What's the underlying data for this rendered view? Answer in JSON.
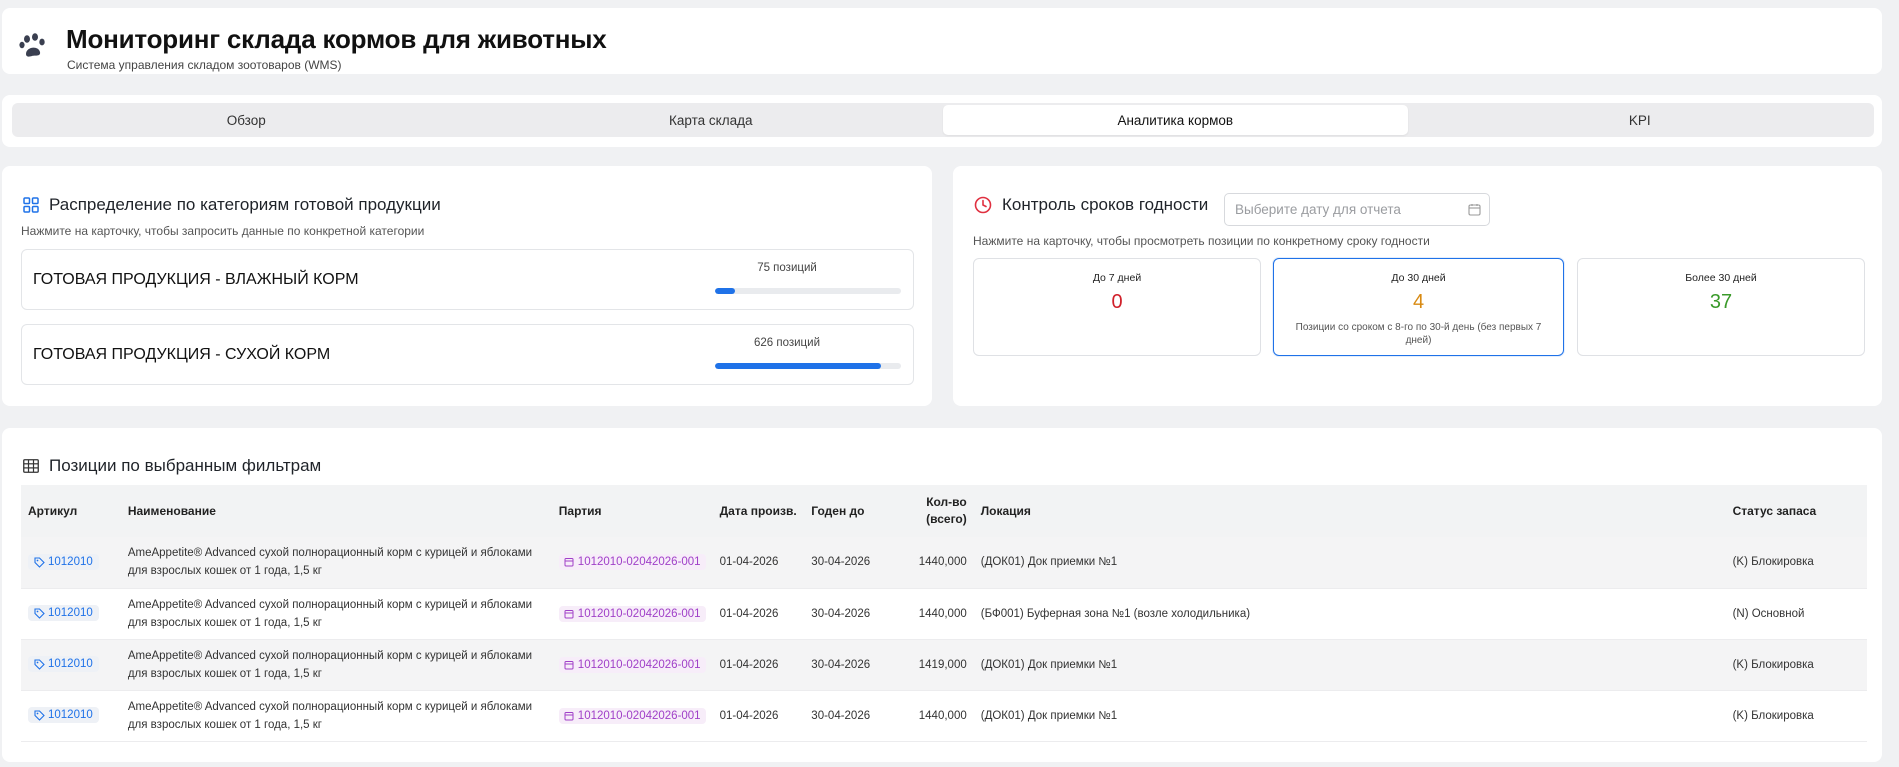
{
  "header": {
    "title": "Мониторинг склада кормов для животных",
    "subtitle": "Система управления складом зоотоваров (WMS)",
    "icon": "paw-icon"
  },
  "tabs": [
    {
      "label": "Обзор",
      "active": false
    },
    {
      "label": "Карта склада",
      "active": false
    },
    {
      "label": "Аналитика кормов",
      "active": true
    },
    {
      "label": "KPI",
      "active": false
    }
  ],
  "categories": {
    "title": "Распределение по категориям готовой продукции",
    "hint": "Нажмите на карточку, чтобы запросить данные по конкретной категории",
    "items": [
      {
        "name": "ГОТОВАЯ ПРОДУКЦИЯ - ВЛАЖНЫЙ КОРМ",
        "count": "75 позиций",
        "progress": 0.11
      },
      {
        "name": "ГОТОВАЯ ПРОДУКЦИЯ - СУХОЙ КОРМ",
        "count": "626 позиций",
        "progress": 0.89
      }
    ]
  },
  "expiry": {
    "title": "Контроль сроков годности",
    "date_placeholder": "Выберите дату для отчета",
    "hint": "Нажмите на карточку, чтобы просмотреть позиции по конкретному сроку годности",
    "cards": [
      {
        "label": "До 7 дней",
        "value": "0",
        "color": "#d0202a",
        "note": ""
      },
      {
        "label": "До 30 дней",
        "value": "4",
        "color": "#d88a12",
        "note": "Позиции со сроком с 8-го по 30-й день (без первых 7 дней)",
        "active": true
      },
      {
        "label": "Более 30 дней",
        "value": "37",
        "color": "#3a9a2a",
        "note": ""
      }
    ]
  },
  "positions": {
    "title": "Позиции по выбранным фильтрам",
    "columns": {
      "sku": "Артикул",
      "name": "Наименование",
      "batch": "Партия",
      "prod_date": "Дата произв.",
      "exp_date": "Годен до",
      "qty": "Кол-во (всего)",
      "location": "Локация",
      "status": "Статус запаса"
    },
    "rows": [
      {
        "sku": "1012010",
        "name": "AmeAppetite® Advanced сухой полнорационный корм с курицей и яблоками для взрослых кошек от 1 года, 1,5 кг",
        "batch": "1012010-02042026-001",
        "prod_date": "01-04-2026",
        "exp_date": "30-04-2026",
        "qty": "1440,000",
        "location": "(ДОК01) Док приемки №1",
        "status": "(K) Блокировка"
      },
      {
        "sku": "1012010",
        "name": "AmeAppetite® Advanced сухой полнорационный корм с курицей и яблоками для взрослых кошек от 1 года, 1,5 кг",
        "batch": "1012010-02042026-001",
        "prod_date": "01-04-2026",
        "exp_date": "30-04-2026",
        "qty": "1440,000",
        "location": "(БФ001) Буферная зона №1 (возле холодильника)",
        "status": "(N) Основной"
      },
      {
        "sku": "1012010",
        "name": "AmeAppetite® Advanced сухой полнорационный корм с курицей и яблоками для взрослых кошек от 1 года, 1,5 кг",
        "batch": "1012010-02042026-001",
        "prod_date": "01-04-2026",
        "exp_date": "30-04-2026",
        "qty": "1419,000",
        "location": "(ДОК01) Док приемки №1",
        "status": "(K) Блокировка"
      },
      {
        "sku": "1012010",
        "name": "AmeAppetite® Advanced сухой полнорационный корм с курицей и яблоками для взрослых кошек от 1 года, 1,5 кг",
        "batch": "1012010-02042026-001",
        "prod_date": "01-04-2026",
        "exp_date": "30-04-2026",
        "qty": "1440,000",
        "location": "(ДОК01) Док приемки №1",
        "status": "(K) Блокировка"
      }
    ]
  }
}
